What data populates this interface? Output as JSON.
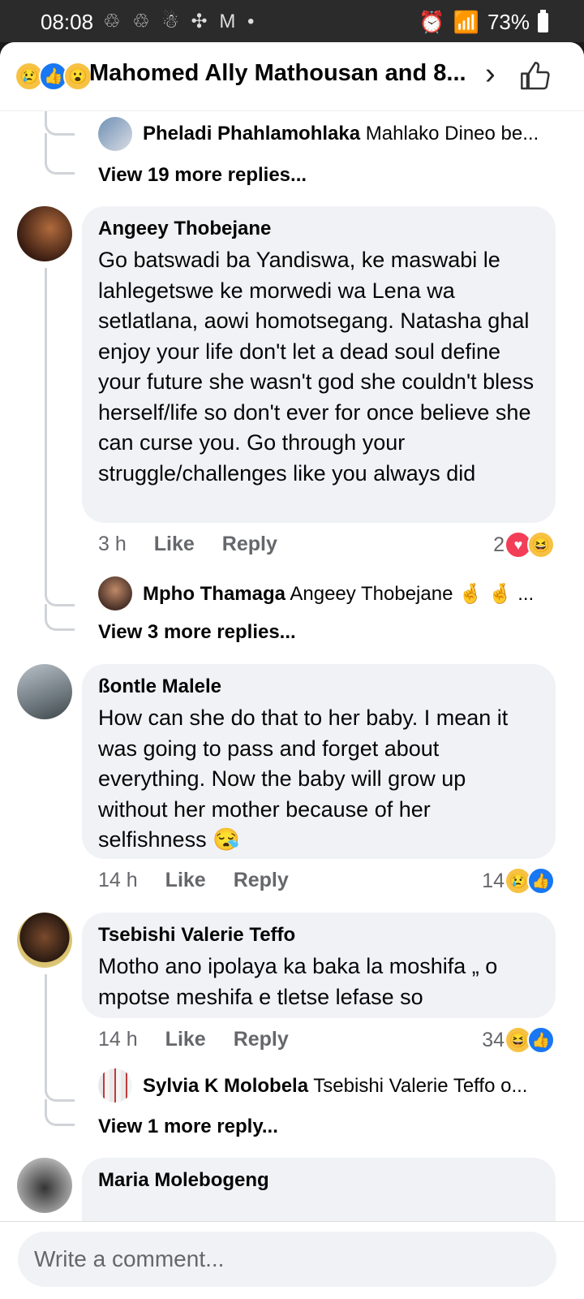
{
  "status_bar": {
    "time": "08:08",
    "left_icons": "♲ ♲ ☃ ✣ M •",
    "battery": "73%"
  },
  "header": {
    "title": "Mahomed Ally Mathousan and 8...",
    "reactions": [
      "sad",
      "like",
      "wow"
    ]
  },
  "thread_prev": {
    "reply": {
      "name": "Pheladi Phahlamohlaka",
      "text": "Mahlako Dineo be..."
    },
    "view_more": "View 19 more replies..."
  },
  "comments": [
    {
      "author": "Angeey Thobejane",
      "text": "Go batswadi ba Yandiswa, ke maswabi le lahlegetswe ke morwedi wa Lena wa setlatlana, aowi homotsegang. Natasha ghal enjoy your life don't let a dead soul define your future she wasn't god she couldn't bless herself/life so don't ever for once believe she can curse you. Go through your struggle/challenges like you always did",
      "time": "3 h",
      "like": "Like",
      "reply": "Reply",
      "reaction_count": "2",
      "reactions": [
        "love",
        "haha"
      ],
      "sub_reply": {
        "name": "Mpho Thamaga",
        "text": "Angeey Thobejane 🤞 🤞 ..."
      },
      "view_more": "View 3 more replies..."
    },
    {
      "author": "ßontle Malele",
      "text": "How can she do that to her baby. I mean it was going to pass and forget about everything. Now the baby will grow up without her mother because of her selfishness 😪",
      "time": "14 h",
      "like": "Like",
      "reply": "Reply",
      "reaction_count": "14",
      "reactions": [
        "sad",
        "like"
      ]
    },
    {
      "author": "Tsebishi Valerie Teffo",
      "text": "Motho ano ipolaya ka baka la moshifa „ o mpotse  meshifa e tletse   lefase  so",
      "time": "14 h",
      "like": "Like",
      "reply": "Reply",
      "reaction_count": "34",
      "reactions": [
        "haha",
        "like"
      ],
      "sub_reply": {
        "name": "Sylvia K Molobela",
        "text": "Tsebishi Valerie Teffo o..."
      },
      "view_more": "View 1 more reply..."
    },
    {
      "author": "Maria Molebogeng"
    }
  ],
  "composer": {
    "placeholder": "Write a comment..."
  },
  "reaction_glyphs": {
    "sad": "😢",
    "like": "👍",
    "wow": "😮",
    "love": "♥",
    "haha": "😆"
  }
}
